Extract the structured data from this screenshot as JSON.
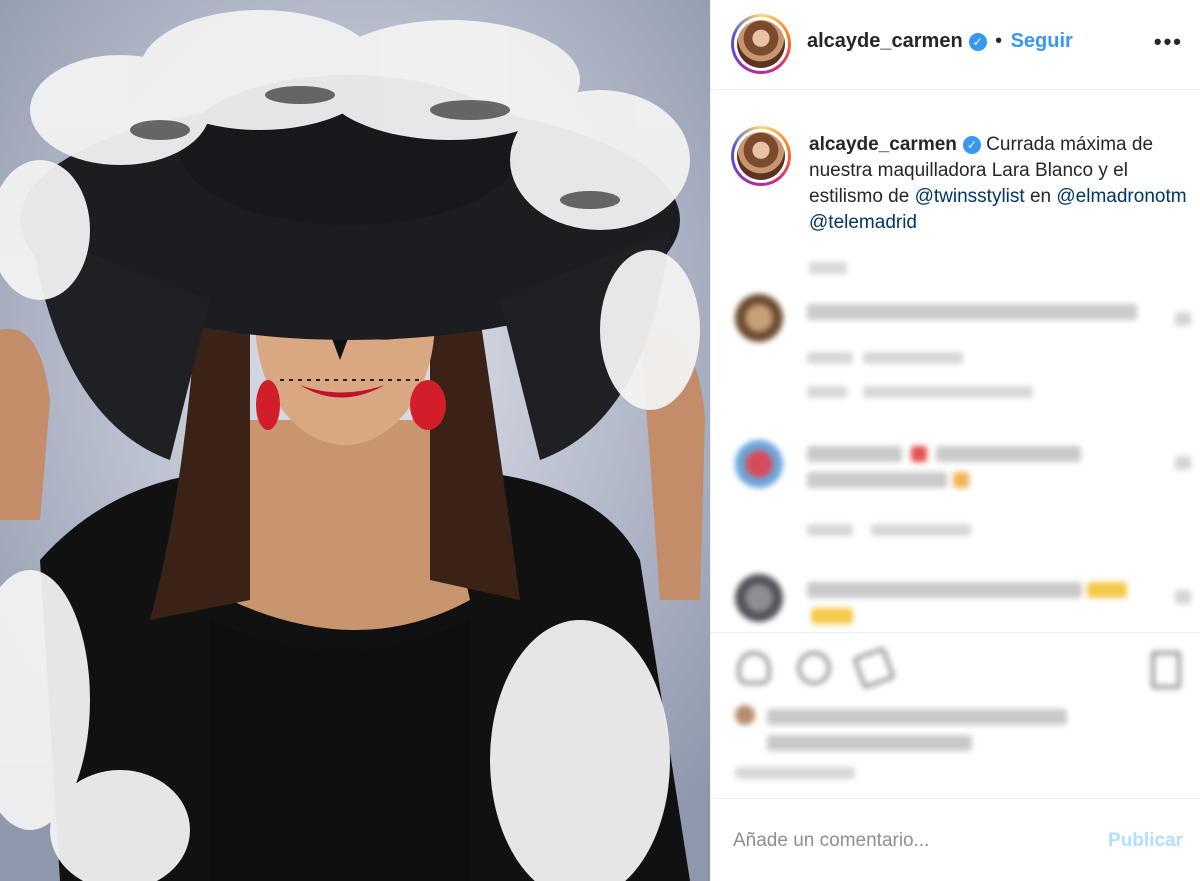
{
  "post": {
    "image_alt": "Mujer con maquillaje de calavera y sombrero negro con plumas",
    "colors": {
      "accent": "#3897f0",
      "mention": "#003569",
      "publish_disabled": "#b2dffc"
    }
  },
  "header": {
    "username": "alcayde_carmen",
    "verified_icon": "verified-badge-icon",
    "separator": "•",
    "follow_label": "Seguir",
    "more_icon": "more-options-icon",
    "more_label": "•••"
  },
  "caption": {
    "username": "alcayde_carmen",
    "text_before": "Currada máxima de nuestra maquilladora Lara Blanco y el estilismo de ",
    "mention1": "@twinsstylist",
    "text_middle": " en ",
    "mention2": "@elmadronotm",
    "mention3": "@telemadrid"
  },
  "icons": {
    "like": "heart-icon",
    "comment": "comment-icon",
    "share": "share-icon",
    "save": "bookmark-icon"
  },
  "add_comment": {
    "placeholder": "Añade un comentario...",
    "publish_label": "Publicar"
  }
}
